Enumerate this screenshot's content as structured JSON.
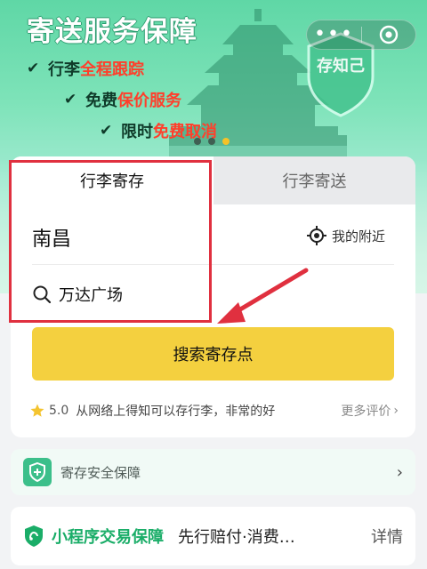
{
  "banner": {
    "title": "寄送服务保障",
    "features": [
      {
        "prefix": "行李",
        "highlight": "全程跟踪"
      },
      {
        "prefix": "免费",
        "highlight": "保价服务"
      },
      {
        "prefix": "限时",
        "highlight": "免费取消"
      }
    ],
    "shield_text": "存知己",
    "carousel": {
      "count": 3,
      "active_index": 2
    }
  },
  "capsule": {
    "more_icon": "more-dots-icon",
    "close_icon": "close-circle-icon"
  },
  "tabs": [
    {
      "label": "行李寄存",
      "active": true
    },
    {
      "label": "行李寄送",
      "active": false
    }
  ],
  "city": "南昌",
  "nearby_label": "我的附近",
  "search": {
    "value": "万达广场",
    "icon": "search-icon"
  },
  "search_button": "搜索寄存点",
  "review": {
    "score": "5.0",
    "text": "从网络上得知可以存行李，非常的好",
    "more": "更多评价"
  },
  "safety": {
    "label": "寄存安全保障",
    "icon": "shield-plus-icon"
  },
  "trade": {
    "name": "小程序交易保障",
    "desc": "先行赔付·消费…",
    "detail": "详情"
  },
  "colors": {
    "accent_green": "#1aad68",
    "banner_green": "#5fd7a6",
    "button_yellow": "#f4d03f",
    "highlight_red": "#e0303f"
  }
}
